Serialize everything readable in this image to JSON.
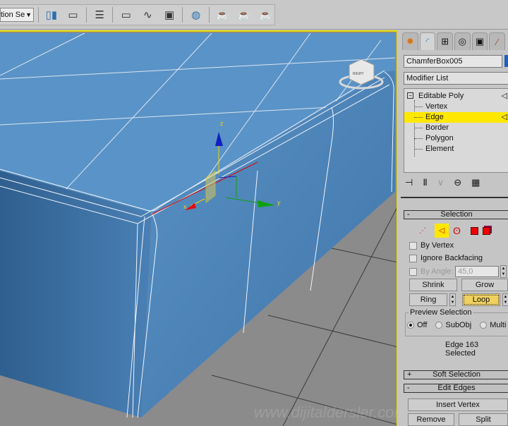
{
  "toolbar": {
    "selection_set_value": "tion Se",
    "icons": [
      "mirror-icon",
      "align-icon",
      "layer-manager-icon",
      "scene-explorer-icon",
      "curve-editor-icon",
      "schematic-view-icon",
      "material-editor-icon",
      "render-setup-icon",
      "rendered-frame-icon",
      "render-icon"
    ]
  },
  "panel": {
    "tabs": [
      "create-icon",
      "modify-icon",
      "hierarchy-icon",
      "motion-icon",
      "display-icon",
      "utilities-icon"
    ],
    "object_name": "ChamferBox005",
    "modifier_list": "Modifier List",
    "stack": [
      {
        "label": "Editable Poly",
        "selected": false
      },
      {
        "label": "Vertex",
        "selected": false
      },
      {
        "label": "Edge",
        "selected": true
      },
      {
        "label": "Border",
        "selected": false
      },
      {
        "label": "Polygon",
        "selected": false
      },
      {
        "label": "Element",
        "selected": false
      }
    ],
    "selection": {
      "title": "Selection",
      "collapse": "-",
      "by_vertex": "By Vertex",
      "ignore_backfacing": "Ignore Backfacing",
      "by_angle": "By Angle:",
      "angle_value": "45,0",
      "shrink": "Shrink",
      "grow": "Grow",
      "ring": "Ring",
      "loop": "Loop",
      "preview_title": "Preview Selection",
      "preview_options": [
        "Off",
        "SubObj",
        "Multi"
      ],
      "preview_selected": "Off",
      "status": "Edge 163 Selected"
    },
    "soft_selection": {
      "title": "Soft Selection",
      "expand": "+"
    },
    "edit_edges": {
      "title": "Edit Edges",
      "collapse": "-",
      "insert_vertex": "Insert Vertex",
      "remove": "Remove",
      "split": "Split"
    }
  },
  "viewport": {
    "gizmo_axes": {
      "x": "x",
      "y": "y",
      "z": "z"
    },
    "viewcube_label": "RIGHT",
    "watermark": "www.dijitaldersler.com"
  },
  "colors": {
    "active_border": "#e8d800",
    "selected_row": "#ffe800",
    "box_blue": "#5a93c7"
  }
}
